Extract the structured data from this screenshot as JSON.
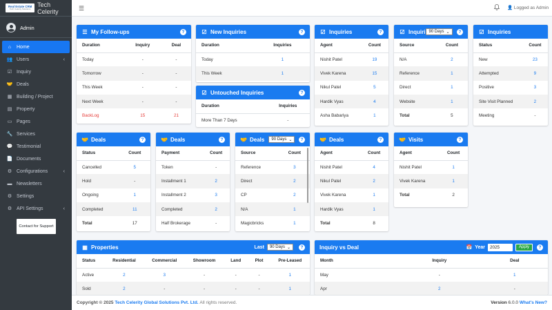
{
  "brand": {
    "logo_line1": "Real Estate CRM",
    "logo_line2": "Tech Celerity Solutions",
    "name": "Tech Celerity"
  },
  "user": {
    "name": "Admin",
    "logged_in": "Logged as Admin"
  },
  "sidebar": {
    "items": [
      {
        "label": "Home",
        "icon": "home-icon",
        "glyph": "⌂",
        "active": true,
        "chev": ""
      },
      {
        "label": "Users",
        "icon": "users-icon",
        "glyph": "👥",
        "active": false,
        "chev": "‹"
      },
      {
        "label": "Inquiry",
        "icon": "inquiry-icon",
        "glyph": "☑",
        "active": false,
        "chev": ""
      },
      {
        "label": "Deals",
        "icon": "deals-icon",
        "glyph": "🤝",
        "active": false,
        "chev": ""
      },
      {
        "label": "Building / Project",
        "icon": "building-icon",
        "glyph": "▦",
        "active": false,
        "chev": ""
      },
      {
        "label": "Property",
        "icon": "property-icon",
        "glyph": "▤",
        "active": false,
        "chev": ""
      },
      {
        "label": "Pages",
        "icon": "pages-icon",
        "glyph": "▭",
        "active": false,
        "chev": ""
      },
      {
        "label": "Services",
        "icon": "wrench-icon",
        "glyph": "🔧",
        "active": false,
        "chev": ""
      },
      {
        "label": "Testimonial",
        "icon": "comments-icon",
        "glyph": "💬",
        "active": false,
        "chev": ""
      },
      {
        "label": "Documents",
        "icon": "documents-icon",
        "glyph": "📄",
        "active": false,
        "chev": ""
      },
      {
        "label": "Configurations",
        "icon": "gears-icon",
        "glyph": "⚙",
        "active": false,
        "chev": "‹"
      },
      {
        "label": "Newsletters",
        "icon": "newsletter-icon",
        "glyph": "▬",
        "active": false,
        "chev": ""
      },
      {
        "label": "Settings",
        "icon": "gear-icon",
        "glyph": "⚙",
        "active": false,
        "chev": ""
      },
      {
        "label": "API Settings",
        "icon": "api-gears-icon",
        "glyph": "⚙",
        "active": false,
        "chev": "‹"
      }
    ],
    "support": "Contact for Support"
  },
  "followups": {
    "title": "My Follow-ups",
    "headers": [
      "Duration",
      "Inquiry",
      "Deal"
    ],
    "rows": [
      {
        "d": "Today",
        "i": "-",
        "dl": "-"
      },
      {
        "d": "Tomorrow",
        "i": "-",
        "dl": "-"
      },
      {
        "d": "This Week",
        "i": "-",
        "dl": "-"
      },
      {
        "d": "Next Week",
        "i": "-",
        "dl": "-"
      },
      {
        "d": "BackLog",
        "i": "15",
        "dl": "21"
      }
    ]
  },
  "new_inquiries": {
    "title": "New Inquiries",
    "headers": [
      "Duration",
      "Inquiries"
    ],
    "rows": [
      {
        "d": "Today",
        "v": "1"
      },
      {
        "d": "This Week",
        "v": "1"
      }
    ]
  },
  "untouched": {
    "title": "Untouched Inquiries",
    "headers": [
      "Duration",
      "Inquiries"
    ],
    "rows": [
      {
        "d": "More Than 7 Days",
        "v": "-"
      }
    ]
  },
  "inq_agent": {
    "title": "Inquiries",
    "headers": [
      "Agent",
      "Count"
    ],
    "rows": [
      {
        "a": "Nishit Patel",
        "c": "19"
      },
      {
        "a": "Vivek Karena",
        "c": "15"
      },
      {
        "a": "Nikul Patel",
        "c": "5"
      },
      {
        "a": "Hardik Vyas",
        "c": "4"
      },
      {
        "a": "Asha Babariya",
        "c": "1"
      }
    ]
  },
  "inq_source": {
    "title": "Inquiri",
    "select": "90 Days",
    "headers": [
      "Source",
      "Count"
    ],
    "rows": [
      {
        "s": "N/A",
        "c": "2"
      },
      {
        "s": "Reference",
        "c": "1"
      },
      {
        "s": "Direct",
        "c": "1"
      },
      {
        "s": "Website",
        "c": "1"
      },
      {
        "s": "Total",
        "c": "5"
      }
    ]
  },
  "inq_status": {
    "title": "Inquiries",
    "headers": [
      "Status",
      "Count"
    ],
    "rows": [
      {
        "s": "New",
        "c": "23"
      },
      {
        "s": "Attempted",
        "c": "9"
      },
      {
        "s": "Positive",
        "c": "3"
      },
      {
        "s": "Site Visit Planned",
        "c": "2"
      },
      {
        "s": "Meeting",
        "c": "-"
      }
    ]
  },
  "deals_status": {
    "title": "Deals",
    "headers": [
      "Status",
      "Count"
    ],
    "rows": [
      {
        "s": "Cancelled",
        "c": "5"
      },
      {
        "s": "Hold",
        "c": "-"
      },
      {
        "s": "Ongoing",
        "c": "1"
      },
      {
        "s": "Completed",
        "c": "11"
      },
      {
        "s": "Total",
        "c": "17"
      }
    ]
  },
  "deals_payment": {
    "title": "Deals",
    "headers": [
      "Payment",
      "Count"
    ],
    "rows": [
      {
        "s": "Token",
        "c": "-"
      },
      {
        "s": "Installment 1",
        "c": "2"
      },
      {
        "s": "Installment 2",
        "c": "3"
      },
      {
        "s": "Completed",
        "c": "2"
      },
      {
        "s": "Half Brokerage",
        "c": "-"
      }
    ]
  },
  "deals_source": {
    "title": "Deals",
    "select": "90 Days",
    "headers": [
      "Source",
      "Count"
    ],
    "rows": [
      {
        "s": "Reference",
        "c": "3"
      },
      {
        "s": "Direct",
        "c": "2"
      },
      {
        "s": "CP",
        "c": "2"
      },
      {
        "s": "N/A",
        "c": "1"
      },
      {
        "s": "Magicbricks",
        "c": "1"
      }
    ]
  },
  "deals_agent": {
    "title": "Deals",
    "headers": [
      "Agent",
      "Count"
    ],
    "rows": [
      {
        "s": "Nishit Patel",
        "c": "4"
      },
      {
        "s": "Nikul Patel",
        "c": "2"
      },
      {
        "s": "Vivek Karena",
        "c": "1"
      },
      {
        "s": "Hardik Vyas",
        "c": "1"
      },
      {
        "s": "Total",
        "c": "8"
      }
    ]
  },
  "visits": {
    "title": "Visits",
    "headers": [
      "Agent",
      "Count"
    ],
    "rows": [
      {
        "s": "Nishit Patel",
        "c": "1"
      },
      {
        "s": "Vivek Karena",
        "c": "1"
      },
      {
        "s": "Total",
        "c": "2"
      }
    ]
  },
  "properties": {
    "title": "Properties",
    "last_label": "Last",
    "select": "90 Days",
    "headers": [
      "Status",
      "Residential",
      "Commercial",
      "Showroom",
      "Land",
      "Plot",
      "Pre-Leased"
    ],
    "rows": [
      [
        "Active",
        "2",
        "3",
        "-",
        "-",
        "-",
        "1"
      ],
      [
        "Sold",
        "2",
        "-",
        "-",
        "-",
        "-",
        "1"
      ]
    ]
  },
  "inq_vs_deal": {
    "title": "Inquiry vs Deal",
    "year_label": "Year",
    "year_value": "2025",
    "apply": "Apply",
    "headers": [
      "Month",
      "Inquiry",
      "Deal"
    ],
    "rows": [
      {
        "m": "May",
        "i": "-",
        "d": "1"
      },
      {
        "m": "Apr",
        "i": "2",
        "d": "-"
      }
    ]
  },
  "footer": {
    "copyright": "Copyright © 2025",
    "company": "Tech Celerity Global Solutions Pvt. Ltd.",
    "rights": "All rights reserved.",
    "version_label": "Version",
    "version": "6.0.0",
    "whats_new": "What's New?"
  }
}
